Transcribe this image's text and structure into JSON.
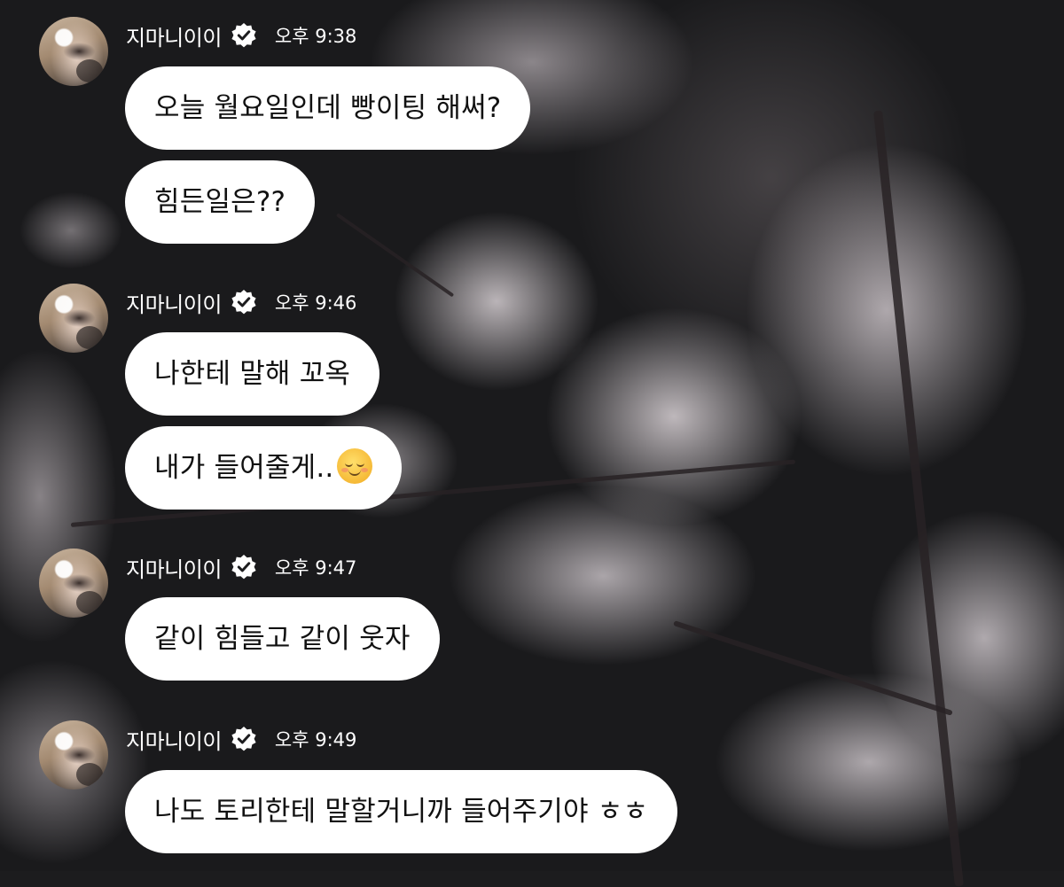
{
  "messages": [
    {
      "sender": "지마니이이",
      "time": "오후 9:38",
      "bubbles": [
        "오늘 월요일인데 빵이팅 해써?",
        "힘든일은??"
      ]
    },
    {
      "sender": "지마니이이",
      "time": "오후 9:46",
      "bubbles": [
        "나한테 말해 꼬옥",
        "내가 들어줄게.."
      ]
    },
    {
      "sender": "지마니이이",
      "time": "오후 9:47",
      "bubbles": [
        "같이 힘들고 같이 웃자"
      ]
    },
    {
      "sender": "지마니이이",
      "time": "오후 9:49",
      "bubbles": [
        "나도 토리한테 말할거니까 들어주기야 ㅎㅎ"
      ]
    }
  ],
  "icons": {
    "verified": "verified-check-icon",
    "emoji": "smiling-face-emoji"
  },
  "colors": {
    "bubble": "#ffffff",
    "bubble_text": "#111111",
    "header_text": "#ffffff",
    "verified_badge": "#ffffff"
  }
}
